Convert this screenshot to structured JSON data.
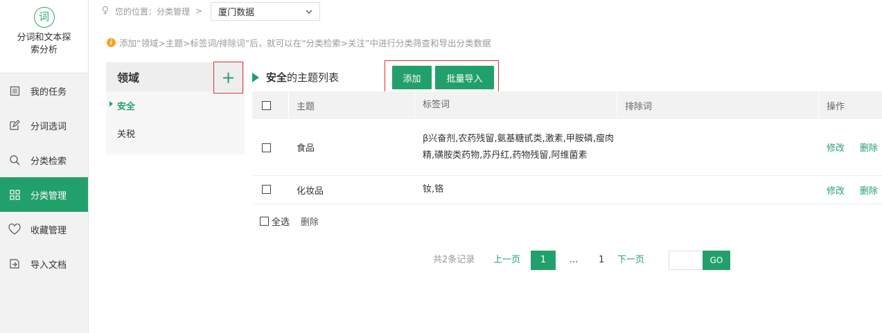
{
  "sidebar": {
    "logo_char": "词",
    "title": "分词和文本探索分析",
    "items": [
      {
        "label": "我的任务",
        "icon": "list-icon"
      },
      {
        "label": "分词选词",
        "icon": "edit-icon"
      },
      {
        "label": "分类检索",
        "icon": "search-icon"
      },
      {
        "label": "分类管理",
        "icon": "grid-icon"
      },
      {
        "label": "收藏管理",
        "icon": "heart-icon"
      },
      {
        "label": "导入文档",
        "icon": "import-icon"
      }
    ],
    "active_index": 3
  },
  "breadcrumb": {
    "prefix": "您的位置：",
    "section": "分类管理",
    "separator": ">",
    "selected": "厦门数据"
  },
  "tip": "添加“领域>主题>标签词/排除词”后，就可以在“分类检索>关注”中进行分类筛查和导出分类数据",
  "domain_panel": {
    "title": "领域",
    "add_symbol": "+",
    "items": [
      "安全",
      "关税"
    ],
    "active_index": 0
  },
  "topic_list": {
    "title_domain": "安全",
    "title_suffix": "的主题列表",
    "add_label": "添加",
    "bulk_import_label": "批量导入",
    "columns": [
      "主题",
      "标签词",
      "排除词",
      "操作"
    ],
    "rows": [
      {
        "topic": "食品",
        "tags": "β兴奋剂,农药残留,氨基糖甙类,激素,甲胺磷,瘦肉精,磺胺类药物,苏丹红,药物残留,阿维菌素",
        "exclude": "",
        "edit": "修改",
        "delete": "删除"
      },
      {
        "topic": "化妆品",
        "tags": "钕,铬",
        "exclude": "",
        "edit": "修改",
        "delete": "删除"
      }
    ],
    "select_all_label": "全选",
    "delete_label": "删除"
  },
  "pagination": {
    "total_text": "共2条记录",
    "prev": "上一页",
    "current": "1",
    "ellipsis": "...",
    "last": "1",
    "next": "下一页",
    "go": "GO"
  },
  "colors": {
    "accent": "#22a06b",
    "highlight_border": "#e03030"
  }
}
